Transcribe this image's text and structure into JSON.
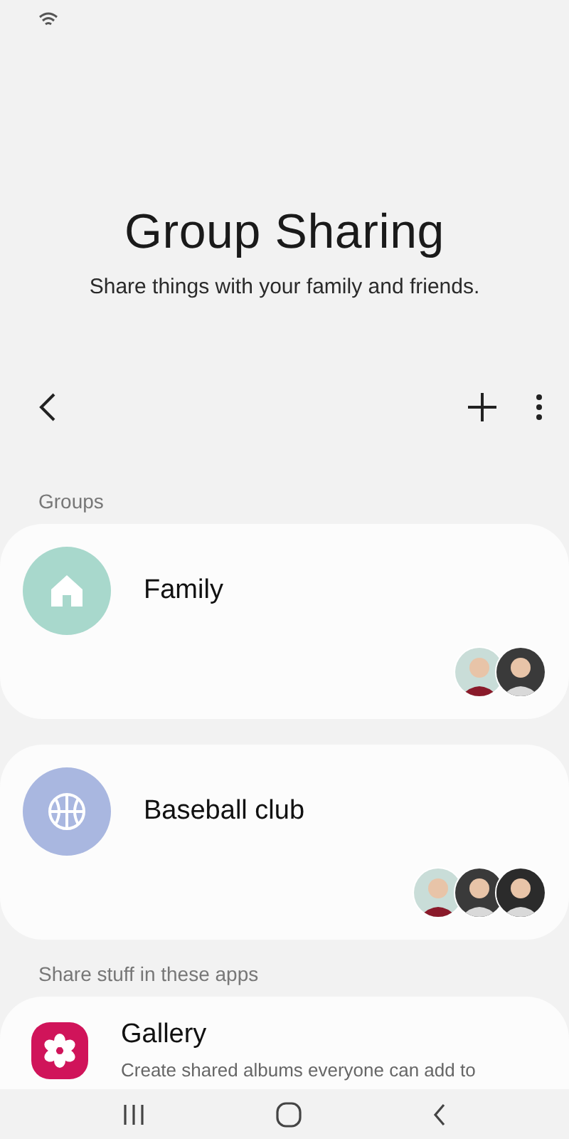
{
  "header": {
    "title": "Group Sharing",
    "subtitle": "Share things with your family and friends."
  },
  "groups_label": "Groups",
  "groups": [
    {
      "name": "Family",
      "kind": "home",
      "color": "#a8d8cc"
    },
    {
      "name": "Baseball club",
      "kind": "ball",
      "color": "#a9b7e0"
    }
  ],
  "apps_label": "Share stuff in these apps",
  "apps": [
    {
      "name": "Gallery",
      "description": "Create shared albums everyone can add to",
      "kind": "flower"
    }
  ]
}
